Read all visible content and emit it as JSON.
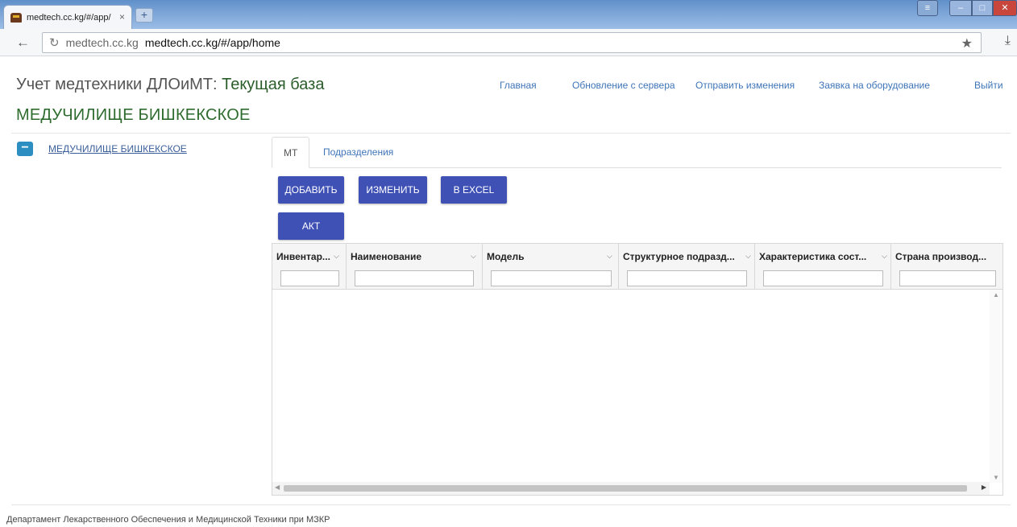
{
  "browser": {
    "tab_title": "medtech.cc.kg/#/app/",
    "tab_close": "×",
    "new_tab": "+",
    "url_host": "medtech.cc.kg",
    "url_full": "medtech.cc.kg/#/app/home"
  },
  "header": {
    "title_prefix": "Учет медтехники ДЛОиМТ: ",
    "title_db": "Текущая база",
    "subtitle": "МЕДУЧИЛИЩЕ БИШКЕКСКОЕ"
  },
  "nav": {
    "home": "Главная",
    "update": "Обновление с сервера",
    "send": "Отправить изменения",
    "request": "Заявка на оборудование",
    "logout": "Выйти"
  },
  "tree": {
    "toggle": "−",
    "item": "МЕДУЧИЛИЩЕ БИШКЕКСКОЕ"
  },
  "tabs": {
    "mt": "МТ",
    "divisions": "Подразделения"
  },
  "buttons": {
    "add": "ДОБАВИТЬ",
    "edit": "ИЗМЕНИТЬ",
    "excel": "В EXCEL",
    "act": "АКТ"
  },
  "grid": {
    "columns": [
      "Инвентар...",
      "Наименование",
      "Модель",
      "Структурное подразд...",
      "Характеристика сост...",
      "Страна производ..."
    ],
    "rows": []
  },
  "footer": {
    "text": "Департамент Лекарственного Обеспечения и Медицинской Техники при МЗКР"
  }
}
